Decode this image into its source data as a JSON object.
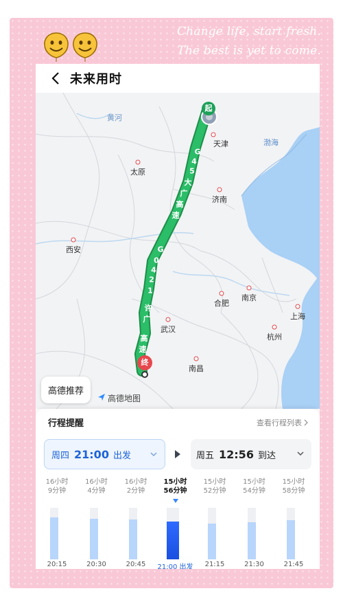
{
  "decor": {
    "tagline1": "Change life, start fresh.",
    "tagline2": "The best is yet to come."
  },
  "header": {
    "title": "未来用时"
  },
  "map": {
    "cities": [
      {
        "name": "天津"
      },
      {
        "name": "太原"
      },
      {
        "name": "济南"
      },
      {
        "name": "西安"
      },
      {
        "name": "合肥"
      },
      {
        "name": "南京"
      },
      {
        "name": "武汉"
      },
      {
        "name": "杭州"
      },
      {
        "name": "上海"
      },
      {
        "name": "南昌"
      }
    ],
    "rivers": [
      "黄河"
    ],
    "seas": [
      "渤海"
    ],
    "start_marker": "起",
    "end_marker": "终",
    "route_label": "G45大广高速 G0421许广高速",
    "recommend_label": "高德推荐",
    "watermark": "高德地图"
  },
  "panel": {
    "title": "行程提醒",
    "view_list": "查看行程列表",
    "depart": {
      "day": "周四",
      "time": "21:00",
      "action": "出发"
    },
    "arrive": {
      "day": "周五",
      "time": "12:56",
      "action": "到达"
    },
    "options": [
      {
        "dur1": "16小时",
        "dur2": "9分钟",
        "time": "20:15",
        "level": 0.82,
        "selected": false
      },
      {
        "dur1": "16小时",
        "dur2": "4分钟",
        "time": "20:30",
        "level": 0.79,
        "selected": false
      },
      {
        "dur1": "16小时",
        "dur2": "2分钟",
        "time": "20:45",
        "level": 0.78,
        "selected": false
      },
      {
        "dur1": "15小时",
        "dur2": "56分钟",
        "time": "21:00 出发",
        "level": 0.74,
        "selected": true
      },
      {
        "dur1": "15小时",
        "dur2": "52分钟",
        "time": "21:15",
        "level": 0.7,
        "selected": false
      },
      {
        "dur1": "15小时",
        "dur2": "54分钟",
        "time": "21:30",
        "level": 0.72,
        "selected": false
      },
      {
        "dur1": "15小时",
        "dur2": "58分钟",
        "time": "21:45",
        "level": 0.76,
        "selected": false
      }
    ]
  },
  "colors": {
    "frame": "#f9c8d6",
    "route": "#22a85a",
    "accent": "#1e63d6",
    "sea": "#a9d0f5"
  }
}
